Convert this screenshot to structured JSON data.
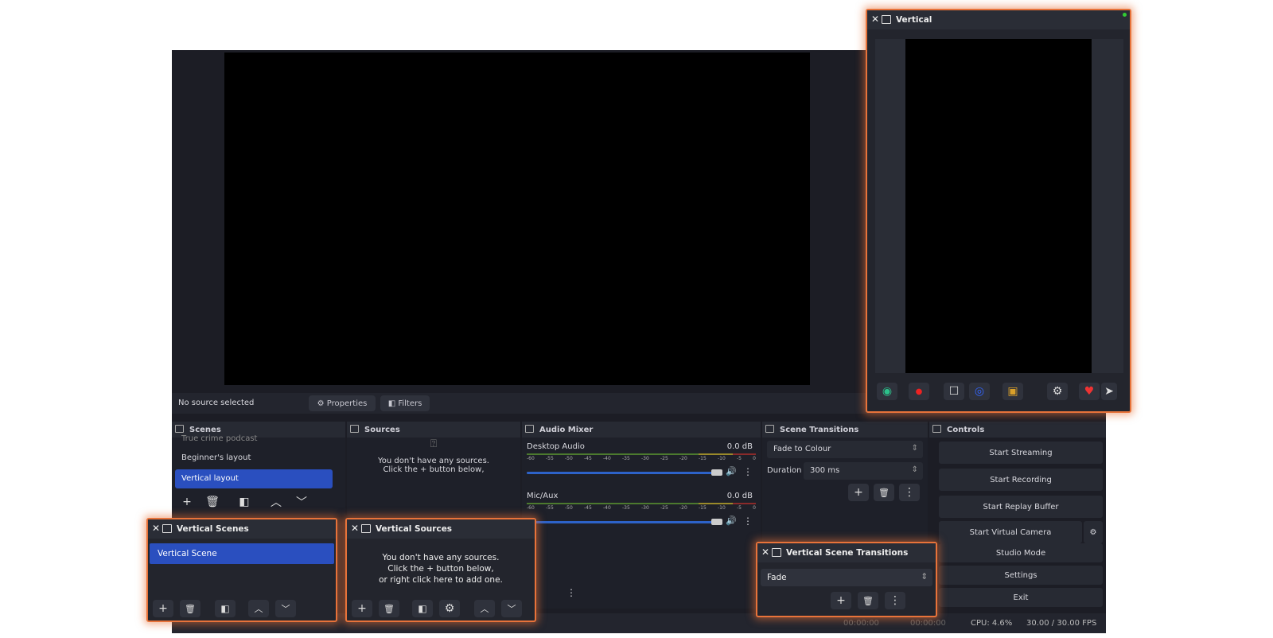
{
  "main": {
    "status": "No source selected",
    "properties": "Properties",
    "filters": "Filters"
  },
  "scenes": {
    "title": "Scenes",
    "items": [
      "True crime podcast",
      "Beginner's layout",
      "Vertical layout"
    ]
  },
  "sources": {
    "title": "Sources",
    "empty_line1": "You don't have any sources.",
    "empty_line2": "Click the + button below,"
  },
  "mixer": {
    "title": "Audio Mixer",
    "ticks": [
      "-60",
      "-55",
      "-50",
      "-45",
      "-40",
      "-35",
      "-30",
      "-25",
      "-20",
      "-15",
      "-10",
      "-5",
      "0"
    ],
    "channels": [
      {
        "name": "Desktop Audio",
        "level": "0.0 dB"
      },
      {
        "name": "Mic/Aux",
        "level": "0.0 dB"
      }
    ]
  },
  "transitions": {
    "title": "Scene Transitions",
    "selected": "Fade to Colour",
    "duration_label": "Duration",
    "duration": "300 ms"
  },
  "controls": {
    "title": "Controls",
    "buttons": [
      "Start Streaming",
      "Start Recording",
      "Start Replay Buffer",
      "Start Virtual Camera",
      "Studio Mode",
      "Settings",
      "Exit"
    ]
  },
  "statusbar": {
    "stream_time": "00:00:00",
    "rec_time": "00:00:00",
    "cpu": "CPU: 4.6%",
    "fps": "30.00 / 30.00 FPS"
  },
  "vertical": {
    "title": "Vertical"
  },
  "vscenes": {
    "title": "Vertical Scenes",
    "items": [
      "Vertical Scene"
    ]
  },
  "vsources": {
    "title": "Vertical Sources",
    "empty_line1": "You don't have any sources.",
    "empty_line2": "Click the + button below,",
    "empty_line3": "or right click here to add one."
  },
  "vtransitions": {
    "title": "Vertical Scene Transitions",
    "selected": "Fade"
  },
  "colors": {
    "accent": "#e8733a",
    "selection": "#2a4fbf"
  }
}
